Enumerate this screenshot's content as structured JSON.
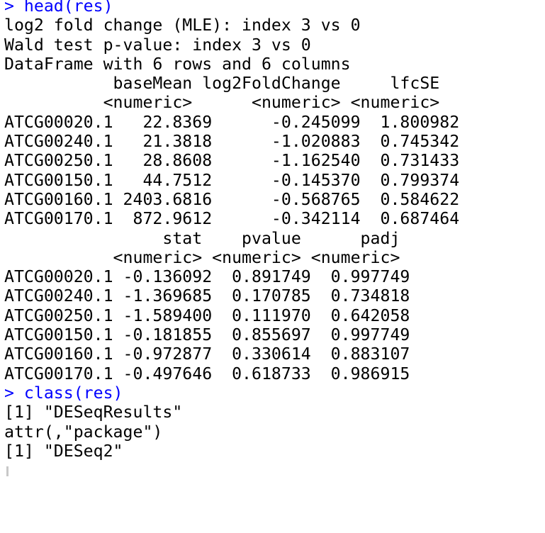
{
  "console": {
    "lines": [
      {
        "kind": "cmd",
        "text": "> head(res)"
      },
      {
        "kind": "out",
        "text": "log2 fold change (MLE): index 3 vs 0"
      },
      {
        "kind": "out",
        "text": "Wald test p-value: index 3 vs 0"
      },
      {
        "kind": "out",
        "text": "DataFrame with 6 rows and 6 columns"
      },
      {
        "kind": "out",
        "text": "           baseMean log2FoldChange     lfcSE"
      },
      {
        "kind": "out",
        "text": "          <numeric>      <numeric> <numeric>"
      },
      {
        "kind": "out",
        "text": "ATCG00020.1   22.8369      -0.245099  1.800982"
      },
      {
        "kind": "out",
        "text": "ATCG00240.1   21.3818      -1.020883  0.745342"
      },
      {
        "kind": "out",
        "text": "ATCG00250.1   28.8608      -1.162540  0.731433"
      },
      {
        "kind": "out",
        "text": "ATCG00150.1   44.7512      -0.145370  0.799374"
      },
      {
        "kind": "out",
        "text": "ATCG00160.1 2403.6816      -0.568765  0.584622"
      },
      {
        "kind": "out",
        "text": "ATCG00170.1  872.9612      -0.342114  0.687464"
      },
      {
        "kind": "out",
        "text": "                stat    pvalue      padj"
      },
      {
        "kind": "out",
        "text": "           <numeric> <numeric> <numeric>"
      },
      {
        "kind": "out",
        "text": "ATCG00020.1 -0.136092  0.891749  0.997749"
      },
      {
        "kind": "out",
        "text": "ATCG00240.1 -1.369685  0.170785  0.734818"
      },
      {
        "kind": "out",
        "text": "ATCG00250.1 -1.589400  0.111970  0.642058"
      },
      {
        "kind": "out",
        "text": "ATCG00150.1 -0.181855  0.855697  0.997749"
      },
      {
        "kind": "out",
        "text": "ATCG00160.1 -0.972877  0.330614  0.883107"
      },
      {
        "kind": "out",
        "text": "ATCG00170.1 -0.497646  0.618733  0.986915"
      },
      {
        "kind": "cmd",
        "text": "> class(res)"
      },
      {
        "kind": "out",
        "text": "[1] \"DESeqResults\""
      },
      {
        "kind": "out",
        "text": "attr(,\"package\")"
      },
      {
        "kind": "out",
        "text": "[1] \"DESeq2\""
      }
    ],
    "prompt": ""
  },
  "colors": {
    "command": "#0000ff",
    "output": "#000000",
    "background": "#ffffff",
    "caret": "#c8c8c8"
  }
}
